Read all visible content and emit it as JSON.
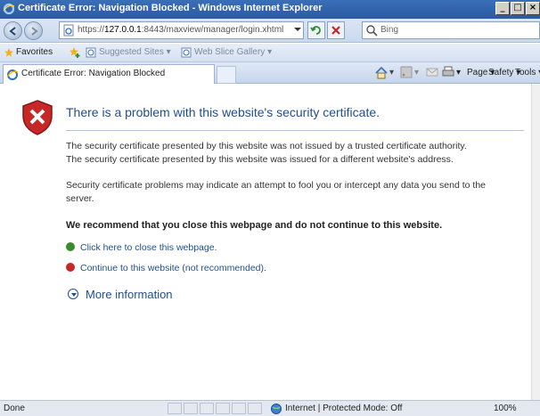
{
  "window": {
    "title": "Certificate Error: Navigation Blocked - Windows Internet Explorer",
    "minimize": "_",
    "maximize": "□",
    "close": "×"
  },
  "address_bar": {
    "url_prefix": "https://",
    "url_host": "127.0.0.1",
    "url_rest": ":8443/maxview/manager/login.xhtml",
    "search_placeholder": "Bing"
  },
  "favorites_bar": {
    "favorites_label": "Favorites",
    "suggested_sites": "Suggested Sites ▾",
    "web_slice_gallery": "Web Slice Gallery ▾"
  },
  "tab": {
    "label": "Certificate Error: Navigation Blocked"
  },
  "command_bar": {
    "page": "Page ▾",
    "safety": "Safety ▾",
    "tools": "Tools ▾"
  },
  "content": {
    "headline": "There is a problem with this website's security certificate.",
    "para1_line1": "The security certificate presented by this website was not issued by a trusted certificate authority.",
    "para1_line2": "The security certificate presented by this website was issued for a different website's address.",
    "para2": "Security certificate problems may indicate an attempt to fool you or intercept any data you send to the server.",
    "recommendation": "We recommend that you close this webpage and do not continue to this website.",
    "close_link": "Click here to close this webpage.",
    "continue_link": "Continue to this website (not recommended).",
    "more_info": "More information"
  },
  "status_bar": {
    "status": "Done",
    "zone": "Internet | Protected Mode: Off",
    "zoom": "100%"
  },
  "colors": {
    "link": "#1f4f8f",
    "title_bar": "#2b5aa0",
    "error_red": "#c62828",
    "ok_green": "#3a8a2e"
  }
}
